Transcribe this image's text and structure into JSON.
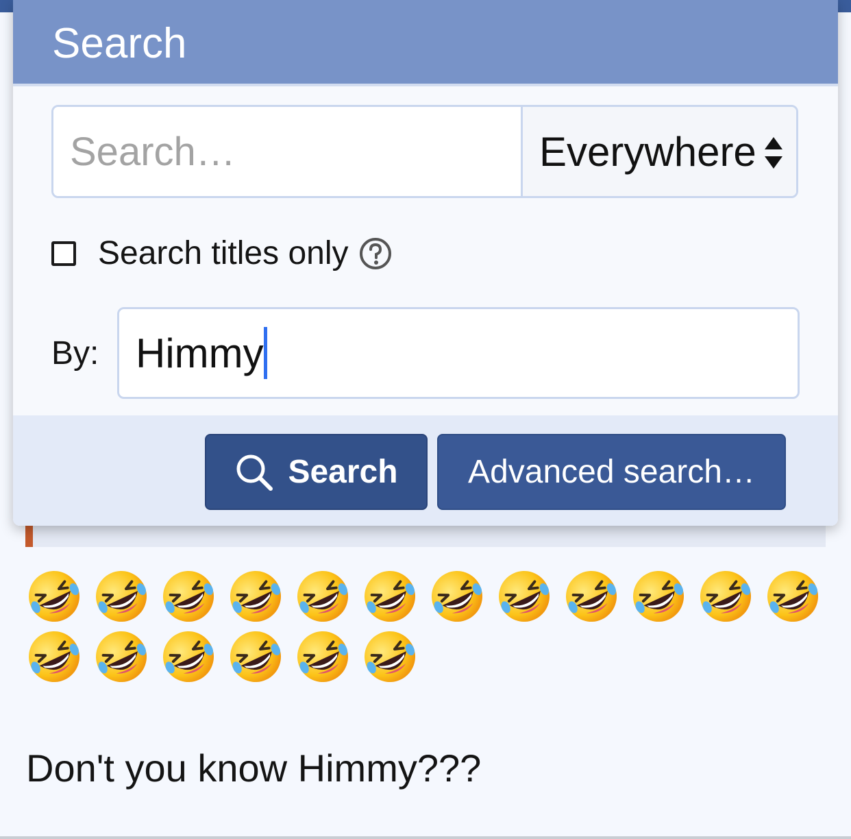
{
  "popup": {
    "title": "Search",
    "search_placeholder": "Search…",
    "scope_value": "Everywhere",
    "titles_only_label": "Search titles only",
    "titles_only_checked": false,
    "by_label": "By:",
    "by_value": "Himmy",
    "search_button_label": "Search",
    "advanced_button_label": "Advanced search…"
  },
  "post": {
    "emoji_name": "rolling-on-the-floor-laughing-emoji",
    "emoji_row1_count": 12,
    "emoji_row2_count": 6,
    "text": "Don't you know Himmy???"
  },
  "colors": {
    "header": "#7893c8",
    "primary_button": "#33518a",
    "secondary_button": "#3a5996",
    "footer": "#e3eaf8",
    "quote_accent": "#c45a2c"
  }
}
